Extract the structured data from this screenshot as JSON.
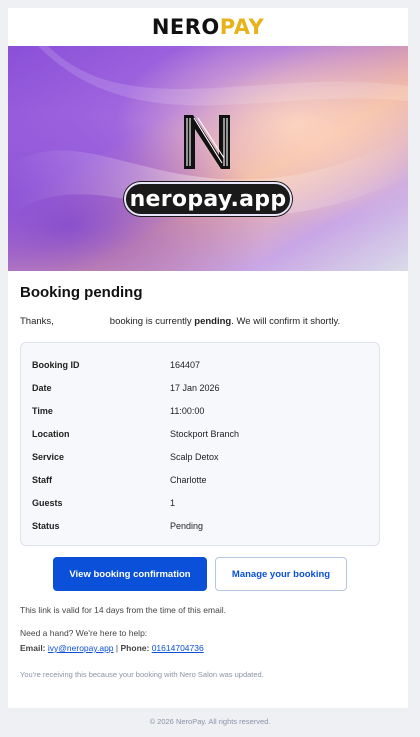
{
  "brand": {
    "name_part1": "NERO",
    "name_part2": "PAY",
    "accent_color": "#e8b21a",
    "site": "neropay.app",
    "mark_letter": "N"
  },
  "heading": "Booking pending",
  "intro": {
    "greeting": "Thanks,",
    "text_before": "booking is currently ",
    "status_word": "pending",
    "text_after": ". We will confirm it shortly."
  },
  "details": [
    {
      "label": "Booking ID",
      "value": "164407"
    },
    {
      "label": "Date",
      "value": "17 Jan 2026"
    },
    {
      "label": "Time",
      "value": "11:00:00"
    },
    {
      "label": "Location",
      "value": "Stockport Branch"
    },
    {
      "label": "Service",
      "value": "Scalp Detox"
    },
    {
      "label": "Staff",
      "value": "Charlotte"
    },
    {
      "label": "Guests",
      "value": "1"
    },
    {
      "label": "Status",
      "value": "Pending"
    }
  ],
  "buttons": {
    "primary": "View booking confirmation",
    "secondary": "Manage your booking",
    "primary_color": "#0a50d8"
  },
  "validity_note": "This link is valid for 14 days from the time of this email.",
  "help_text": "Need a hand? We're here to help:",
  "contact": {
    "email_label": "Email:",
    "email": "ivy@neropay.app",
    "separator": "|",
    "phone_label": "Phone:",
    "phone": "01614704736"
  },
  "fine_print": "You're receiving this because your booking with Nero Salon was updated.",
  "footer": "© 2026 NeroPay. All rights reserved."
}
